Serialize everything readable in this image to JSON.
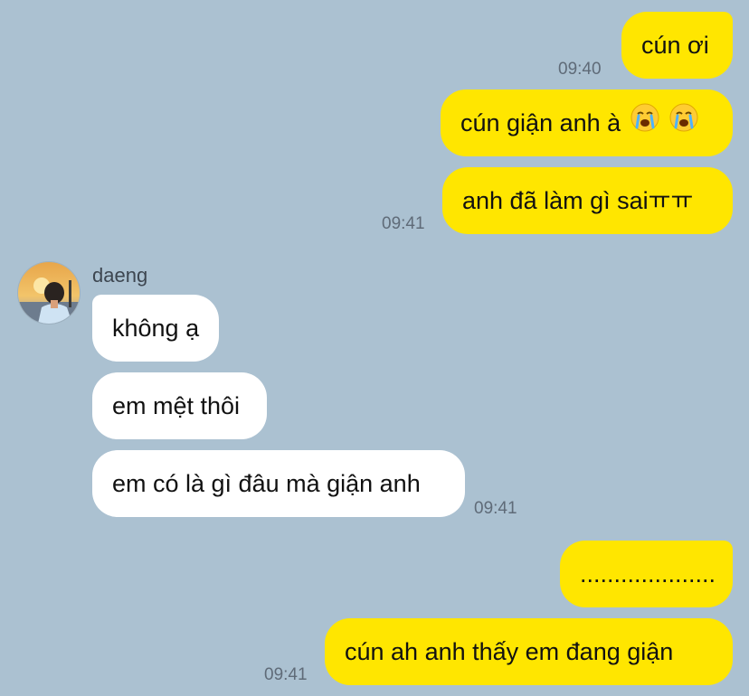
{
  "messages": {
    "m1": {
      "text": "cún ơi"
    },
    "m2": {
      "text": "cún giận anh à",
      "emoji": "crying-face"
    },
    "m3": {
      "text": "anh đã làm gì saiㅠㅠ"
    },
    "m4": {
      "text": "không ạ"
    },
    "m5": {
      "text": "em mệt thôi"
    },
    "m6": {
      "text": "em có là gì đâu mà giận anh"
    },
    "m7": {
      "text": "...................."
    },
    "m8": {
      "text": "cún ah anh thấy em đang giận"
    }
  },
  "times": {
    "t1": "09:40",
    "t2": "09:41",
    "t3": "09:41",
    "t4": "09:41"
  },
  "contact": {
    "name": "daeng"
  },
  "colors": {
    "background": "#abc1d1",
    "outgoing": "#ffe600",
    "incoming": "#ffffff"
  }
}
